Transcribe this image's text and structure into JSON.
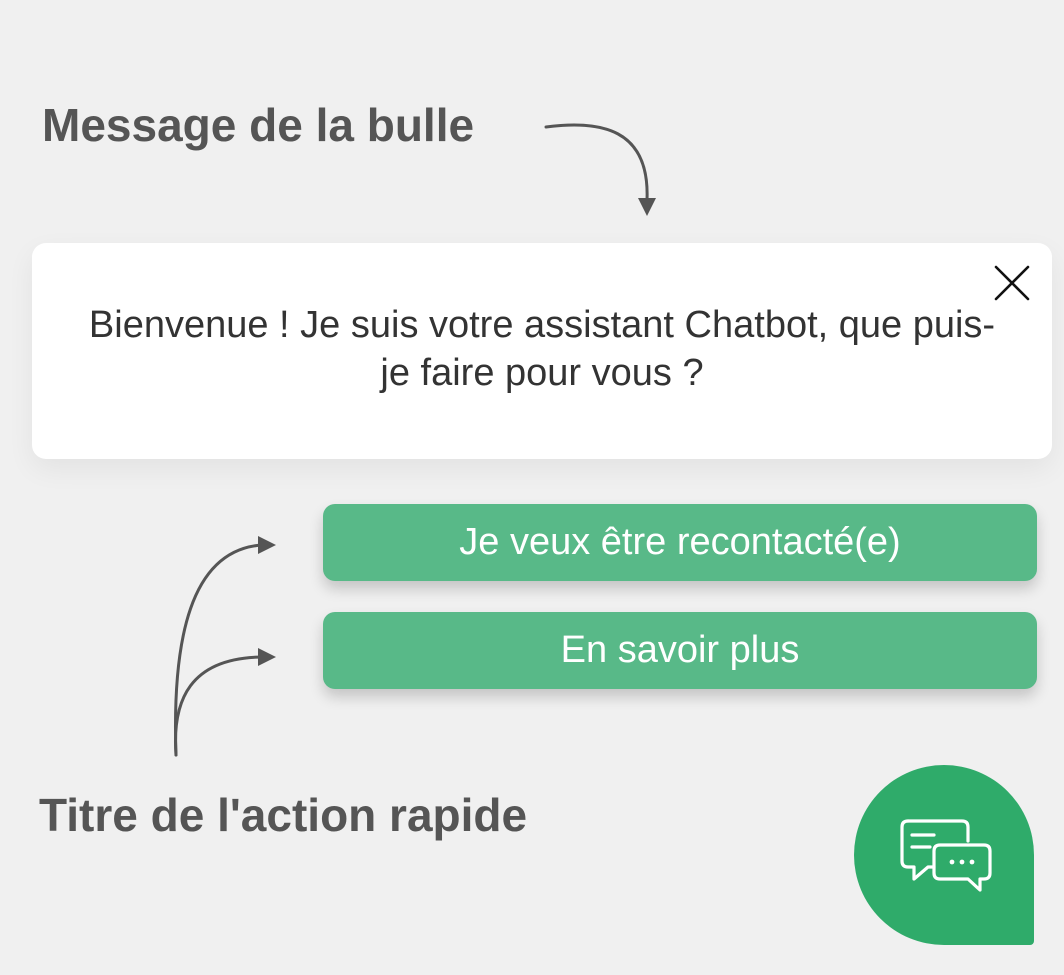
{
  "annotations": {
    "bubble_message_label": "Message de la bulle",
    "quick_action_title_label": "Titre de l'action rapide"
  },
  "bubble": {
    "message": "Bienvenue ! Je suis votre assistant Chatbot, que puis-je faire pour vous ?",
    "close_icon": "close-icon"
  },
  "quick_actions": [
    {
      "label": "Je veux être recontacté(e)"
    },
    {
      "label": "En savoir plus"
    }
  ],
  "launcher": {
    "icon": "chat-bubbles-icon"
  },
  "colors": {
    "background": "#f0f0f0",
    "annotation_text": "#555555",
    "bubble_bg": "#ffffff",
    "bubble_text": "#333333",
    "quick_action_bg": "#58b988",
    "quick_action_text": "#ffffff",
    "launcher_bg": "#2fab6a"
  }
}
